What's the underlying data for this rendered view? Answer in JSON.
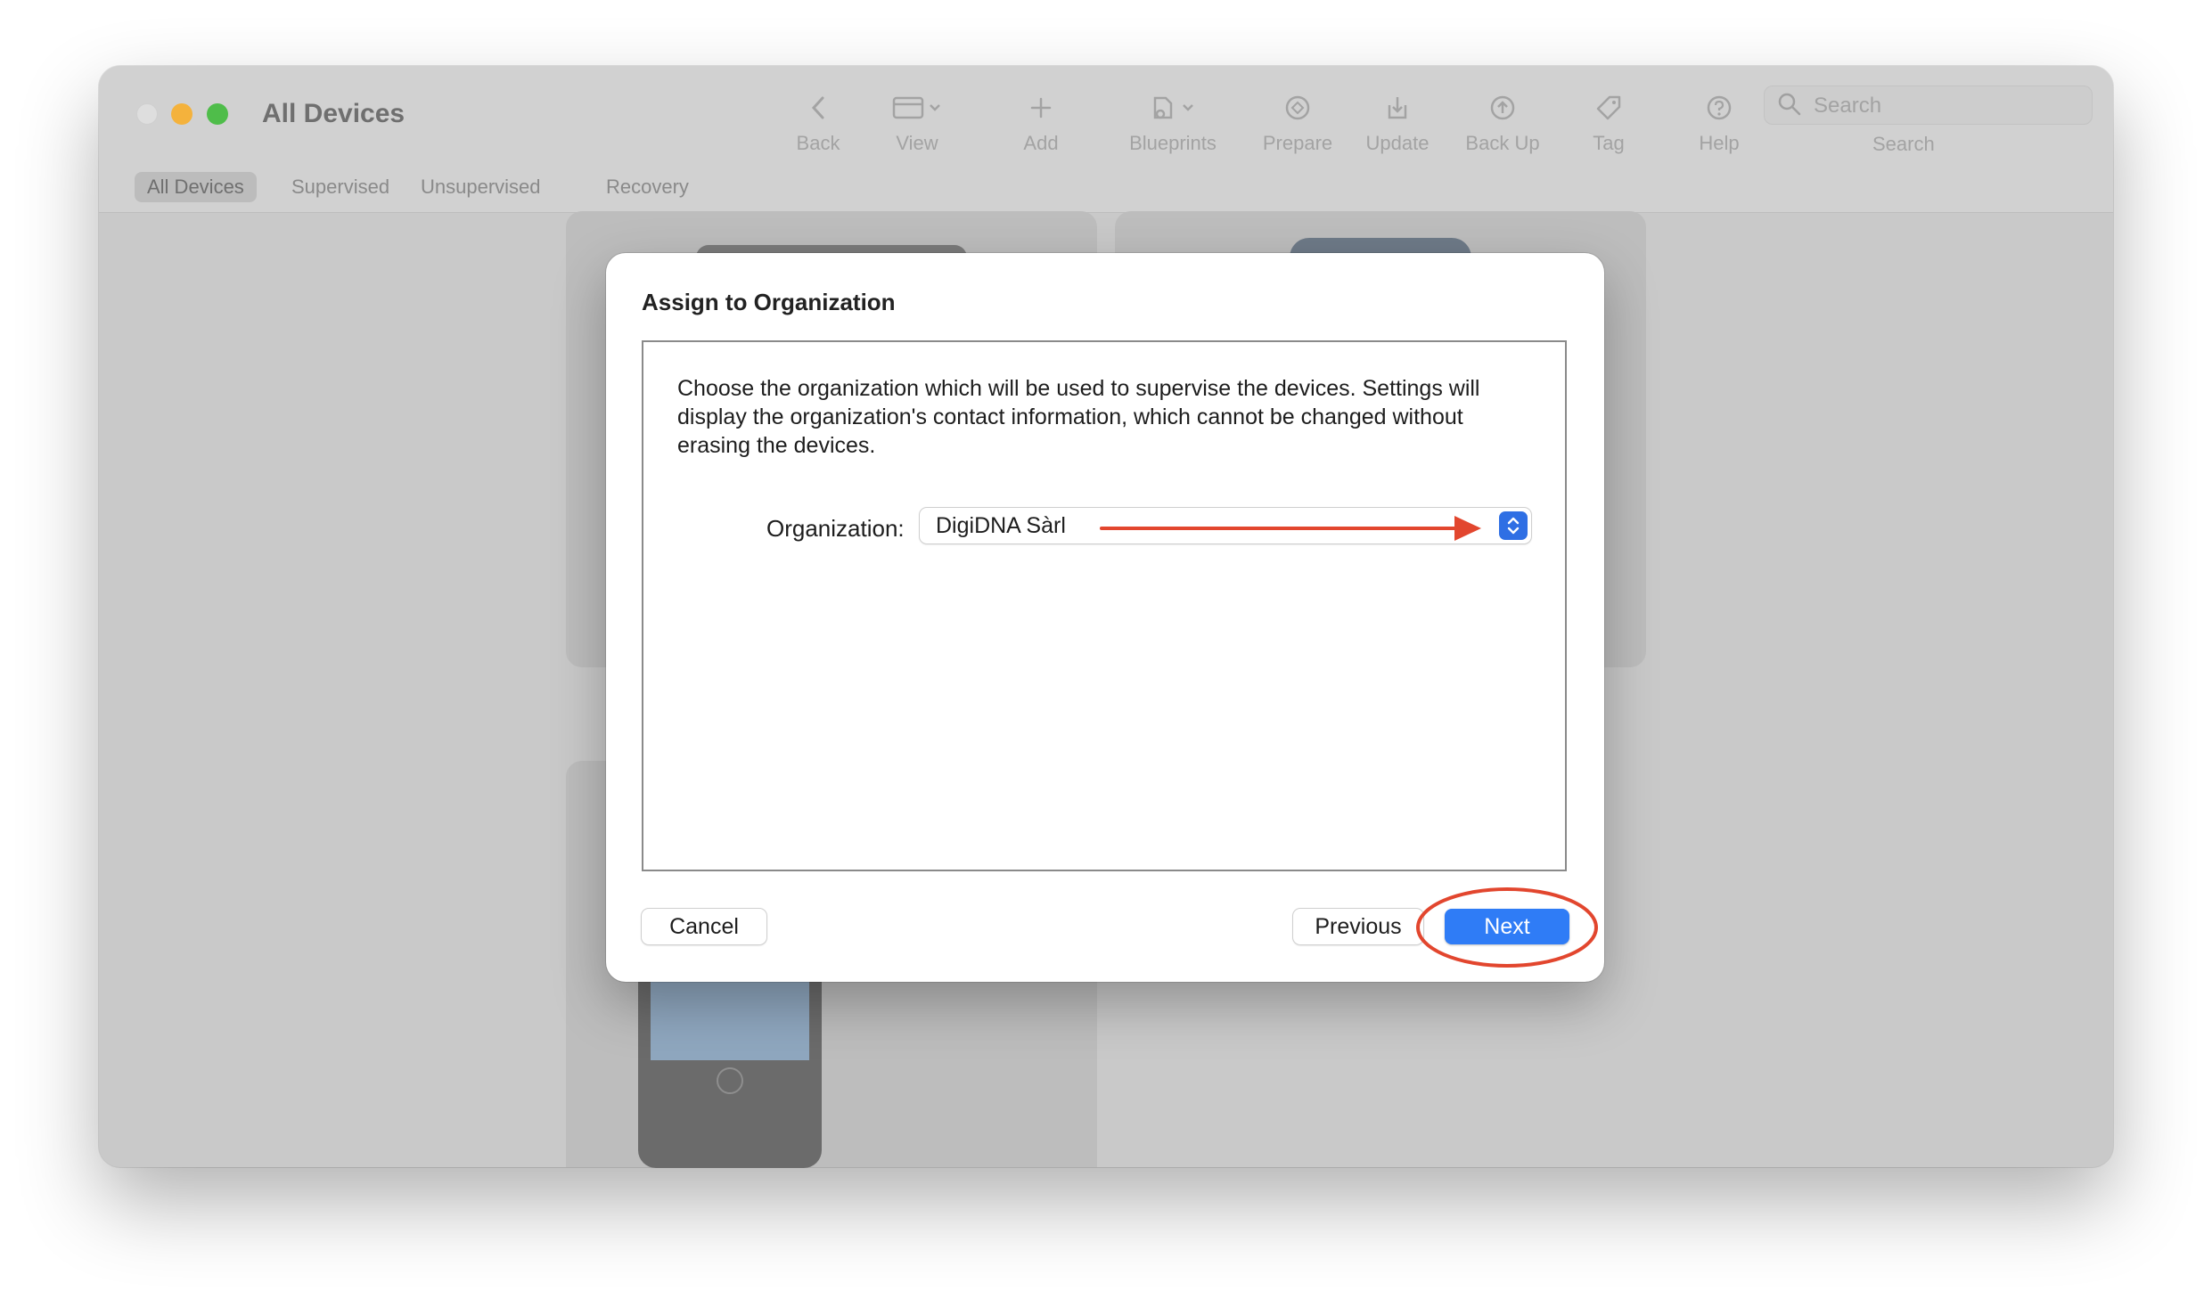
{
  "window": {
    "title": "All Devices"
  },
  "toolbar": {
    "back": {
      "label": "Back",
      "icon": "chevron-left-icon"
    },
    "view": {
      "label": "View",
      "icon": "window-view-icon"
    },
    "add": {
      "label": "Add",
      "icon": "plus-icon"
    },
    "blueprints": {
      "label": "Blueprints",
      "icon": "blueprint-icon"
    },
    "prepare": {
      "label": "Prepare",
      "icon": "prepare-icon"
    },
    "update": {
      "label": "Update",
      "icon": "update-icon"
    },
    "backup": {
      "label": "Back Up",
      "icon": "backup-icon"
    },
    "tag": {
      "label": "Tag",
      "icon": "tag-icon"
    },
    "help": {
      "label": "Help",
      "icon": "help-icon"
    },
    "search": {
      "placeholder": "Search",
      "label": "Search"
    }
  },
  "tabs": [
    {
      "label": "All Devices",
      "active": true
    },
    {
      "label": "Supervised",
      "active": false
    },
    {
      "label": "Unsupervised",
      "active": false
    },
    {
      "label": "Recovery",
      "active": false
    }
  ],
  "dialog": {
    "title": "Assign to Organization",
    "description": "Choose the organization which will be used to supervise the devices. Settings will display the organization's contact information, which cannot be changed without erasing the devices.",
    "org_label": "Organization:",
    "org_value": "DigiDNA Sàrl",
    "cancel_label": "Cancel",
    "previous_label": "Previous",
    "next_label": "Next"
  },
  "colors": {
    "accent": "#2f7cf6",
    "annotation": "#e2462e",
    "traffic_close": "#dedede",
    "traffic_minimize": "#f4b23c",
    "traffic_maximize": "#4fbd4a"
  }
}
